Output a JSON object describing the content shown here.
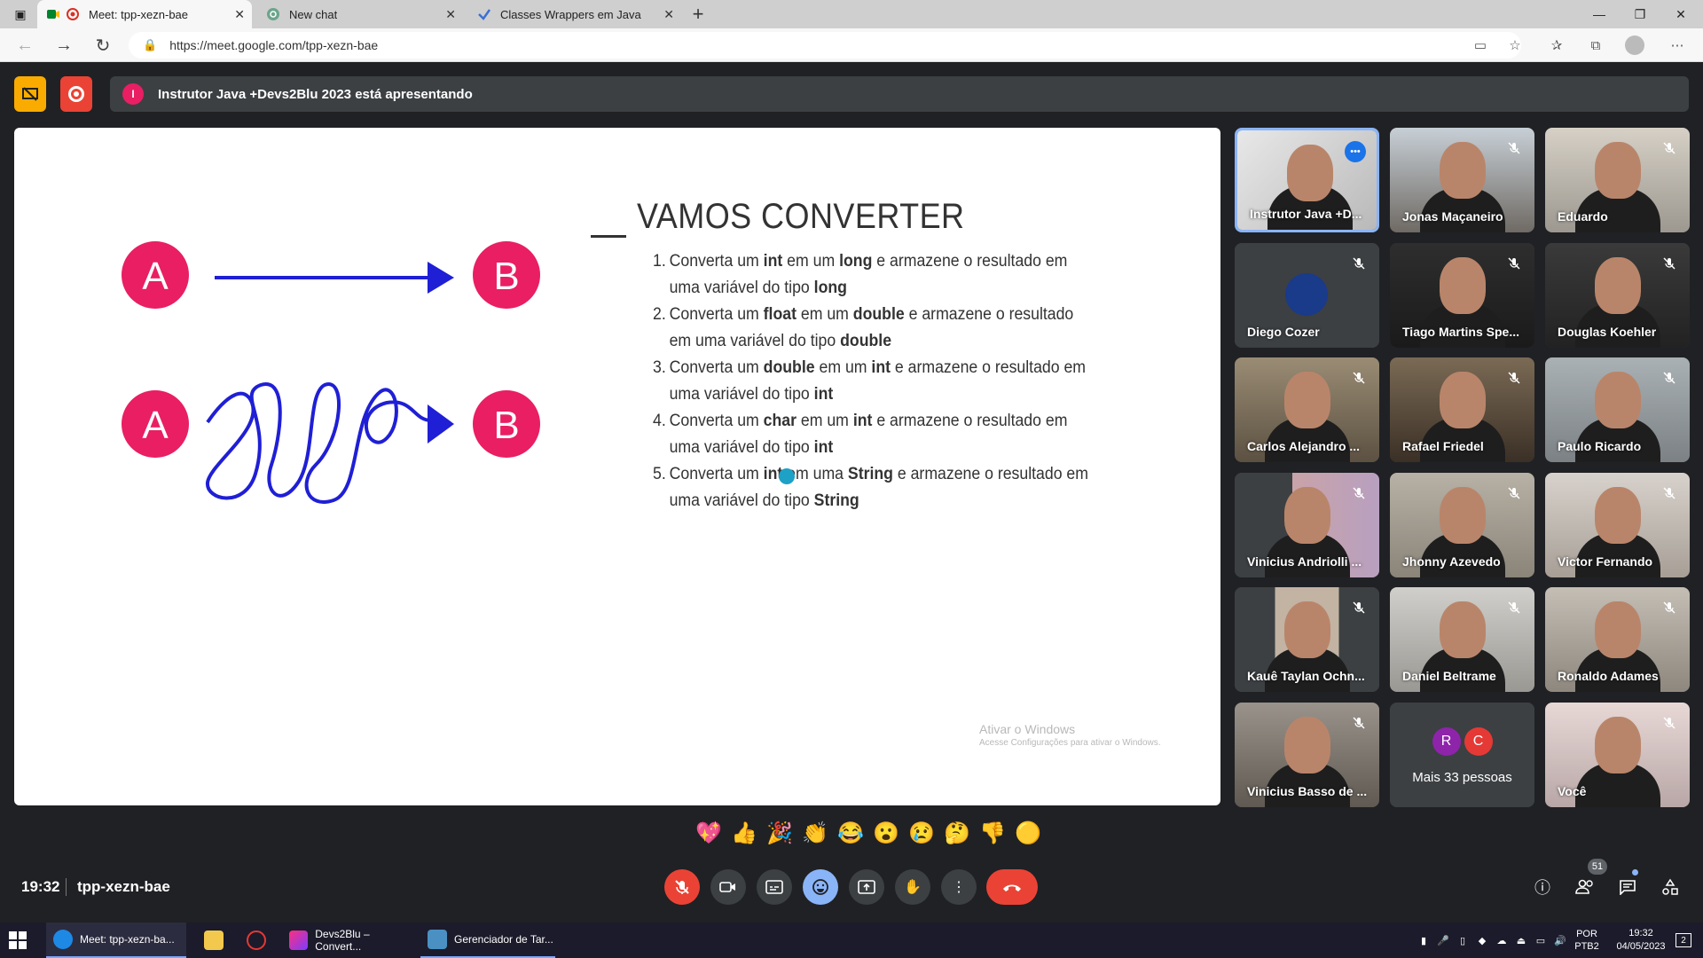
{
  "browser": {
    "tabs": [
      {
        "title": "Meet: tpp-xezn-bae",
        "icon": "meet-icon",
        "active": true
      },
      {
        "title": "New chat",
        "icon": "chat-icon",
        "active": false
      },
      {
        "title": "Classes Wrappers em Java",
        "icon": "site-icon",
        "active": false
      }
    ],
    "url": "https://meet.google.com/tpp-xezn-bae"
  },
  "banner": {
    "avatar_letter": "I",
    "text": "Instrutor Java +Devs2Blu 2023 está apresentando"
  },
  "slide": {
    "title": "VAMOS CONVERTER",
    "diagram": {
      "from_label": "A",
      "to_label": "B"
    },
    "tasks": [
      {
        "num": "1.",
        "parts": [
          "Converta um ",
          "int",
          " em um ",
          "long",
          " e armazene o resultado em uma variável do tipo ",
          "long"
        ]
      },
      {
        "num": "2.",
        "parts": [
          "Converta um ",
          "float",
          " em um ",
          "double",
          " e armazene o resultado em uma variável do tipo ",
          "double"
        ]
      },
      {
        "num": "3.",
        "parts": [
          "Converta um ",
          "double",
          " em um ",
          "int",
          " e armazene o resultado em uma variável do tipo ",
          "int"
        ]
      },
      {
        "num": "4.",
        "parts": [
          "Converta um ",
          "char",
          " em um ",
          "int",
          " e armazene o resultado em uma variável do tipo ",
          "int"
        ]
      },
      {
        "num": "5.",
        "parts": [
          "Converta um ",
          "int",
          " em uma ",
          "String",
          " e armazene o resultado em uma variável do tipo ",
          "String"
        ]
      }
    ],
    "watermark_title": "Ativar o Windows",
    "watermark_sub": "Acesse Configurações para ativar o Windows."
  },
  "participants": [
    {
      "name": "Instrutor Java +D...",
      "muted": false,
      "speaking": true
    },
    {
      "name": "Jonas Maçaneiro",
      "muted": true
    },
    {
      "name": "Eduardo",
      "muted": true
    },
    {
      "name": "Diego Cozer",
      "muted": true
    },
    {
      "name": "Tiago Martins Spe...",
      "muted": true
    },
    {
      "name": "Douglas Koehler",
      "muted": true
    },
    {
      "name": "Carlos Alejandro ...",
      "muted": true
    },
    {
      "name": "Rafael Friedel",
      "muted": true
    },
    {
      "name": "Paulo Ricardo",
      "muted": true
    },
    {
      "name": "Vinicius Andriolli ...",
      "muted": true
    },
    {
      "name": "Jhonny Azevedo",
      "muted": true
    },
    {
      "name": "Victor Fernando",
      "muted": true
    },
    {
      "name": "Kauê Taylan Ochn...",
      "muted": true
    },
    {
      "name": "Daniel Beltrame",
      "muted": true
    },
    {
      "name": "Ronaldo Adames",
      "muted": true
    },
    {
      "name": "Vinicius Basso de ...",
      "muted": true
    },
    {
      "more": true,
      "label": "Mais 33 pessoas",
      "letters": [
        "R",
        "C"
      ]
    },
    {
      "name": "Você",
      "muted": true
    }
  ],
  "reactions": [
    "💖",
    "👍",
    "🎉",
    "👏",
    "😂",
    "😮",
    "😢",
    "🤔",
    "👎",
    "🟡"
  ],
  "footer": {
    "time": "19:32",
    "meeting_code": "tpp-xezn-bae",
    "people_count": "51"
  },
  "taskbar": {
    "items": [
      {
        "label": "Meet: tpp-xezn-ba...",
        "icon": "edge-icon",
        "active": true
      },
      {
        "label": "",
        "icon": "folder-icon",
        "active": false
      },
      {
        "label": "",
        "icon": "app-icon",
        "active": false
      },
      {
        "label": "Devs2Blu – Convert...",
        "icon": "intellij-icon",
        "active": false
      },
      {
        "label": "Gerenciador de Tar...",
        "icon": "task-manager-icon",
        "active": false
      }
    ],
    "lang": "POR",
    "layout": "PTB2",
    "time": "19:32",
    "date": "04/05/2023",
    "notification_count": "2"
  },
  "colors": {
    "accent_blue": "#8ab4f8",
    "red": "#ea4335",
    "yellow": "#f9ab00",
    "pink_circle": "#e91e63",
    "arrow_blue": "#1f1fd6"
  }
}
